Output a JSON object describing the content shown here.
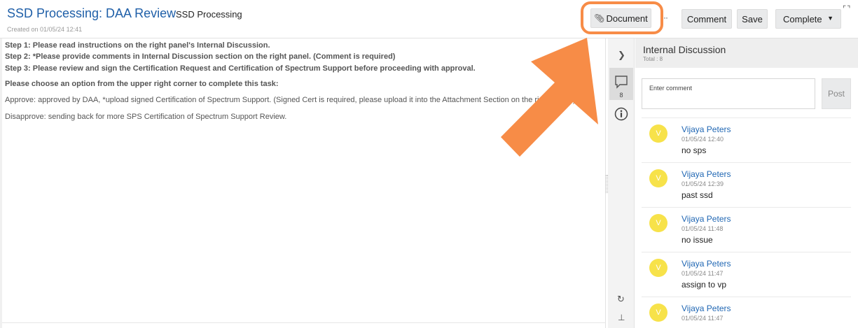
{
  "header": {
    "title": "SSD Processing: DAA Review",
    "subtitle": "SSD Processing",
    "created": "Created on 01/05/24 12:41",
    "buttons": {
      "document": "Document",
      "more": "··",
      "comment": "Comment",
      "save": "Save",
      "complete": "Complete"
    },
    "icons": {
      "document": "paperclip-icon",
      "complete_caret": "caret-down-icon",
      "expand": "expand-icon"
    }
  },
  "instructions": {
    "step1": "Step 1: Please read instructions on the right panel's Internal Discussion.",
    "step2": "Step 2: *Please provide comments in Internal Discussion section on the right panel. (Comment is required)",
    "step3": "Step 3: Please review and sign the Certification Request and Certification of Spectrum Support before proceeding with approval.",
    "choose": "Please choose an option from the upper right corner to complete this task:",
    "approve": "Approve: approved by DAA, *upload signed Certification of Spectrum Support. (Signed Cert is required, please upload it into the Attachment Section on the right panel.)",
    "disapprove": "Disapprove: sending back for more SPS Certification of Spectrum Support Review."
  },
  "rail": {
    "comment_count": "8",
    "icons": [
      "chevron-right-icon",
      "comment-icon",
      "info-icon",
      "refresh-icon",
      "pin-icon"
    ]
  },
  "discussion": {
    "title": "Internal Discussion",
    "total": "Total : 8",
    "input_placeholder": "Enter comment",
    "post_label": "Post",
    "comments": [
      {
        "initial": "V",
        "author": "Vijaya Peters",
        "time": "01/05/24 12:40",
        "text": "no sps"
      },
      {
        "initial": "V",
        "author": "Vijaya Peters",
        "time": "01/05/24 12:39",
        "text": "past ssd"
      },
      {
        "initial": "V",
        "author": "Vijaya Peters",
        "time": "01/05/24 11:48",
        "text": "no issue"
      },
      {
        "initial": "V",
        "author": "Vijaya Peters",
        "time": "01/05/24 11:47",
        "text": "assign to vp"
      },
      {
        "initial": "V",
        "author": "Vijaya Peters",
        "time": "01/05/24 11:47",
        "text": ""
      }
    ]
  },
  "colors": {
    "accent_blue": "#1f5fa8",
    "author_blue": "#1f66b3",
    "highlight_orange": "#f78c47",
    "avatar_yellow": "#f7e24a"
  }
}
